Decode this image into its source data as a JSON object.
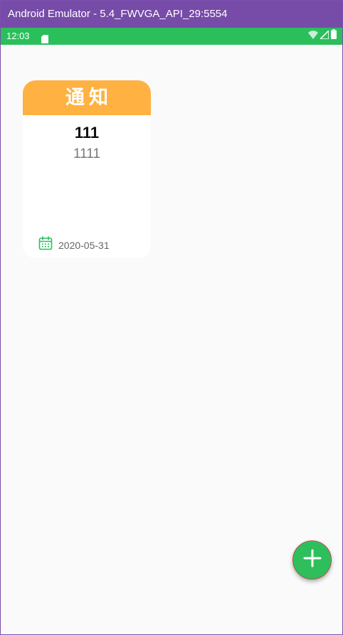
{
  "window": {
    "title": "Android Emulator - 5.4_FWVGA_API_29:5554",
    "title_bar_color": "#774ba8"
  },
  "status_bar": {
    "time": "12:03",
    "color": "#2bbf5c",
    "icons": [
      "sim-card-icon",
      "wifi-icon",
      "cell-signal-icon",
      "battery-icon"
    ]
  },
  "notice_card": {
    "header": "通知",
    "header_color": "#ffb142",
    "title": "111",
    "body": "1111",
    "date": "2020-05-31",
    "date_icon": "calendar-icon"
  },
  "fab": {
    "icon": "plus-icon",
    "color": "#2ebf5c"
  }
}
